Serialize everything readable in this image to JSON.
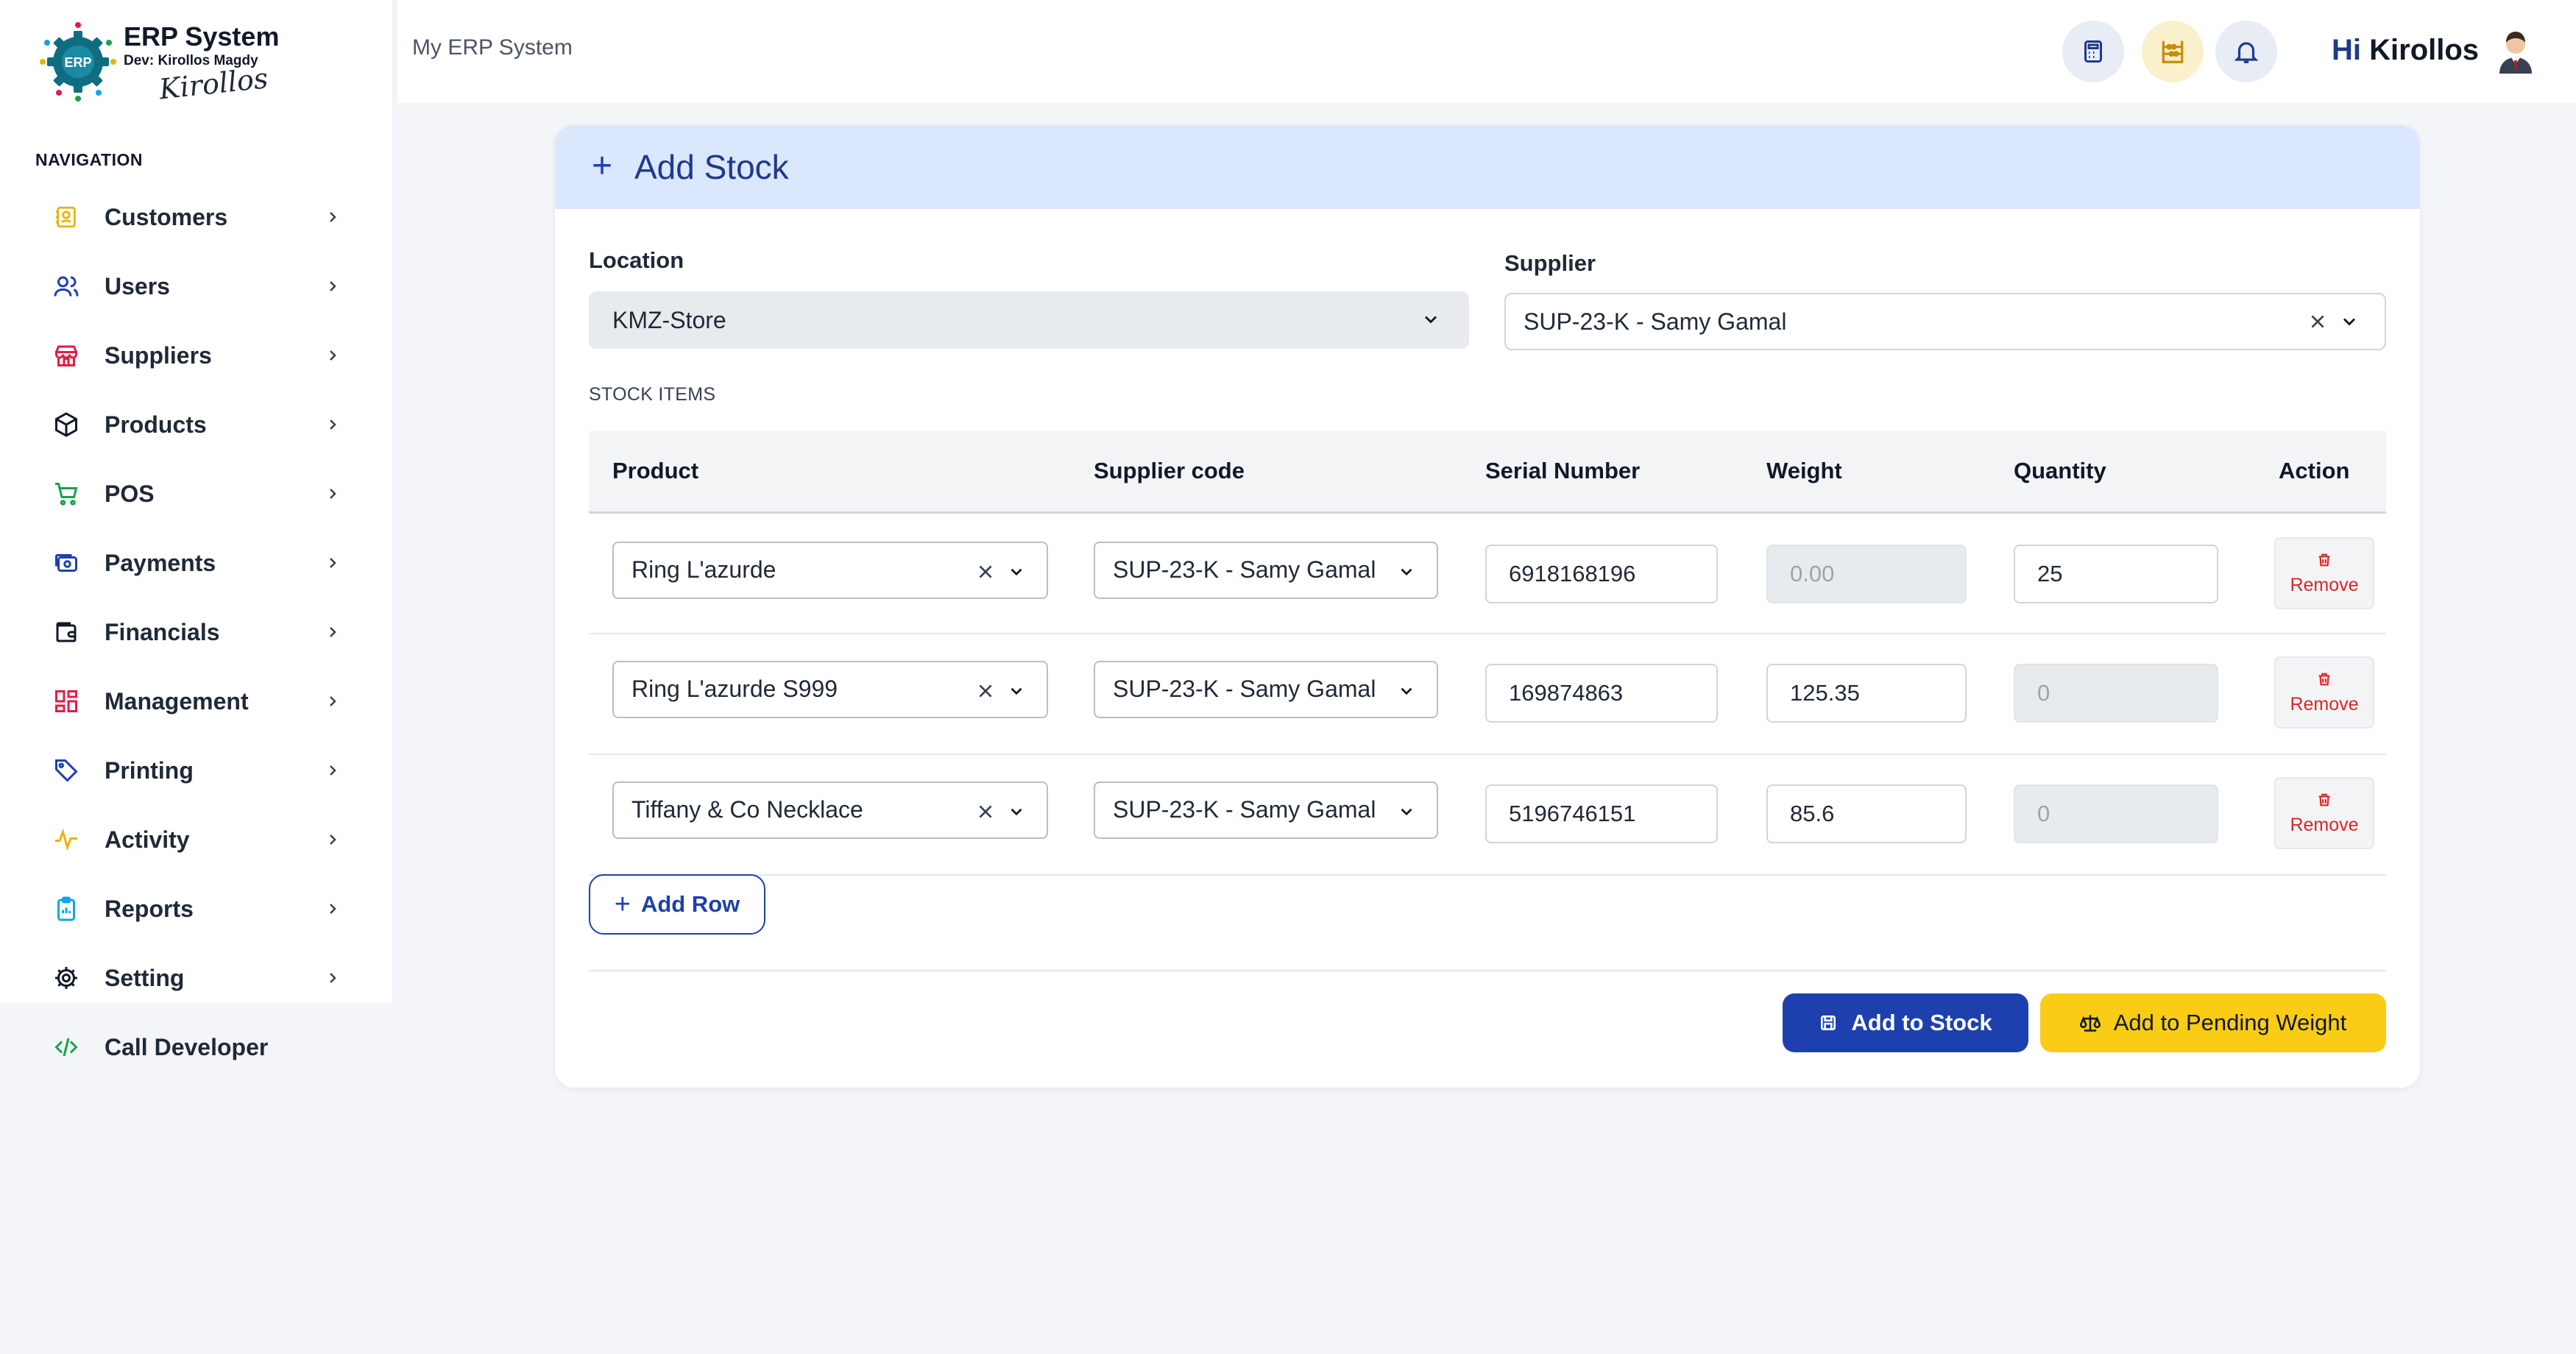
{
  "app": {
    "title": "ERP System",
    "subtitle": "Dev: Kirollos Magdy",
    "signature": "Kirollos",
    "logo_text": "ERP"
  },
  "sidebar": {
    "heading": "NAVIGATION",
    "items": [
      {
        "label": "Customers",
        "icon": "contacts-icon",
        "color": "#eab308"
      },
      {
        "label": "Users",
        "icon": "users-icon",
        "color": "#1e40af"
      },
      {
        "label": "Suppliers",
        "icon": "store-icon",
        "color": "#e11d48"
      },
      {
        "label": "Products",
        "icon": "box-icon",
        "color": "#111827"
      },
      {
        "label": "POS",
        "icon": "cart-icon",
        "color": "#16a34a"
      },
      {
        "label": "Payments",
        "icon": "payment-icon",
        "color": "#1e40af"
      },
      {
        "label": "Financials",
        "icon": "wallet-icon",
        "color": "#111827"
      },
      {
        "label": "Management",
        "icon": "grid-icon",
        "color": "#e11d48"
      },
      {
        "label": "Printing",
        "icon": "tag-icon",
        "color": "#1e40af"
      },
      {
        "label": "Activity",
        "icon": "activity-icon",
        "color": "#eab308"
      },
      {
        "label": "Reports",
        "icon": "clipboard-icon",
        "color": "#0ea5e9"
      },
      {
        "label": "Setting",
        "icon": "gear-icon",
        "color": "#111827"
      }
    ],
    "call_developer": "Call Developer"
  },
  "topbar": {
    "breadcrumb": "My ERP System",
    "greeting": "Hi",
    "user_name": "Kirollos"
  },
  "form": {
    "title": "Add Stock",
    "location_label": "Location",
    "location_value": "KMZ-Store",
    "supplier_label": "Supplier",
    "supplier_value": "SUP-23-K - Samy Gamal",
    "section_label": "STOCK ITEMS",
    "columns": [
      "Product",
      "Supplier code",
      "Serial Number",
      "Weight",
      "Quantity",
      "Action"
    ],
    "rows": [
      {
        "product": "Ring L'azurde",
        "supplier_code": "SUP-23-K - Samy Gamal",
        "serial": "6918168196",
        "weight": "0.00",
        "weight_disabled": true,
        "quantity": "25",
        "quantity_disabled": false,
        "action": "Remove"
      },
      {
        "product": "Ring L'azurde S999",
        "supplier_code": "SUP-23-K - Samy Gamal",
        "serial": "169874863",
        "weight": "125.35",
        "weight_disabled": false,
        "quantity": "0",
        "quantity_disabled": true,
        "action": "Remove"
      },
      {
        "product": "Tiffany & Co Necklace",
        "supplier_code": "SUP-23-K - Samy Gamal",
        "serial": "5196746151",
        "weight": "85.6",
        "weight_disabled": false,
        "quantity": "0",
        "quantity_disabled": true,
        "action": "Remove"
      }
    ],
    "add_row_label": "Add Row",
    "add_to_stock_label": "Add to Stock",
    "add_pending_label": "Add to Pending Weight"
  },
  "colors": {
    "primary": "#1e40af",
    "warning": "#facc15",
    "header_bg": "#dbe7fc",
    "danger": "#dc2626"
  }
}
